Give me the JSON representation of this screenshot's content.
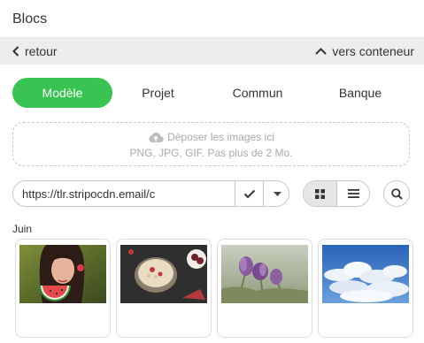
{
  "panel": {
    "title": "Blocs"
  },
  "nav": {
    "back_label": "retour",
    "container_label": "vers conteneur"
  },
  "tabs": [
    {
      "label": "Modèle",
      "active": true
    },
    {
      "label": "Projet",
      "active": false
    },
    {
      "label": "Commun",
      "active": false
    },
    {
      "label": "Banque",
      "active": false
    }
  ],
  "dropzone": {
    "title": "Déposer les images ici",
    "hint": "PNG, JPG, GIF. Pas plus de 2 Mo."
  },
  "url": {
    "value": "https://tlr.stripocdn.email/c"
  },
  "gallery": {
    "section_label": "Juin",
    "items": [
      {
        "icon": "woman-watermelon-image"
      },
      {
        "icon": "oatmeal-bowl-image"
      },
      {
        "icon": "purple-flowers-image"
      },
      {
        "icon": "sky-clouds-image"
      }
    ]
  },
  "colors": {
    "accent": "#39c352",
    "navbar_bg": "#eceded",
    "border": "#c8c8c8"
  }
}
